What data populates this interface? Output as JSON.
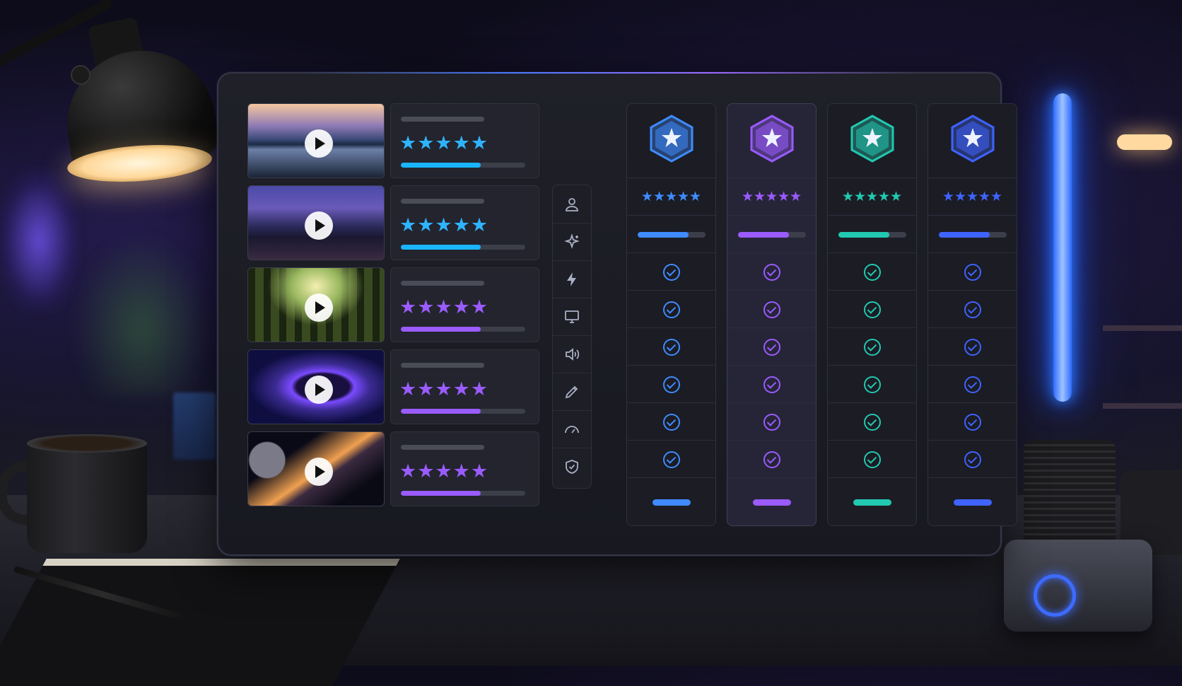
{
  "colors": {
    "blue": "#3f8bff",
    "cyan": "#19b6ff",
    "purple": "#9a5bff",
    "teal": "#22c8b0",
    "indigo": "#3f63ff"
  },
  "videos": [
    {
      "thumb": "mountain-lake",
      "rating": "★★★★★",
      "progress": 0.64,
      "color": "#19b6ff",
      "stars_color": "#2fb3ff"
    },
    {
      "thumb": "city-night",
      "rating": "★★★★★",
      "progress": 0.64,
      "color": "#19b6ff",
      "stars_color": "#2fb3ff"
    },
    {
      "thumb": "forest-path",
      "rating": "★★★★★",
      "progress": 0.64,
      "color": "#9a5bff",
      "stars_color": "#9a5bff"
    },
    {
      "thumb": "neon-tunnel",
      "rating": "★★★★★",
      "progress": 0.64,
      "color": "#9a5bff",
      "stars_color": "#9a5bff"
    },
    {
      "thumb": "space-planet",
      "rating": "★★★★★",
      "progress": 0.64,
      "color": "#9a5bff",
      "stars_color": "#9a5bff"
    }
  ],
  "feature_icons": [
    "user-icon",
    "sparkle-icon",
    "lightning-icon",
    "monitor-icon",
    "speaker-icon",
    "pen-icon",
    "speedometer-icon",
    "shield-icon"
  ],
  "plans": [
    {
      "color": "#3f8bff",
      "rating": "★★★★★",
      "progress": 0.75,
      "checks": 6,
      "featured": false
    },
    {
      "color": "#9a5bff",
      "rating": "★★★★★",
      "progress": 0.75,
      "checks": 6,
      "featured": true
    },
    {
      "color": "#22c8b0",
      "rating": "★★★★★",
      "progress": 0.75,
      "checks": 6,
      "featured": false
    },
    {
      "color": "#3f63ff",
      "rating": "★★★★★",
      "progress": 0.75,
      "checks": 6,
      "featured": false
    }
  ]
}
